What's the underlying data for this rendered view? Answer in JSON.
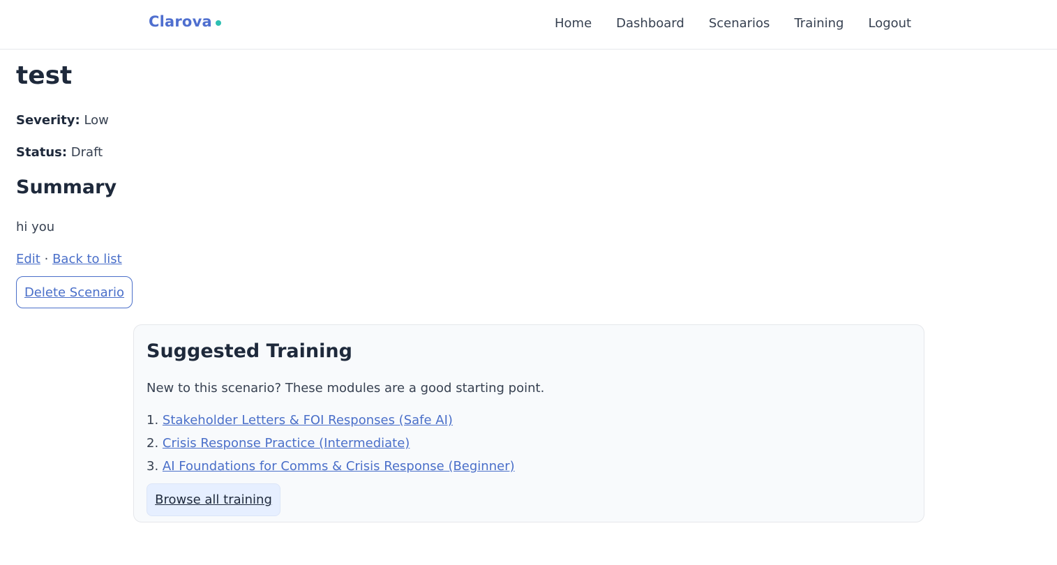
{
  "header": {
    "brand": "Clarova",
    "nav": [
      "Home",
      "Dashboard",
      "Scenarios",
      "Training",
      "Logout"
    ]
  },
  "scenario": {
    "title": "test",
    "severity_label": "Severity:",
    "severity_value": "Low",
    "status_label": "Status:",
    "status_value": "Draft",
    "summary_heading": "Summary",
    "summary_text": "hi you",
    "edit_link": "Edit",
    "separator": "·",
    "back_link": "Back to list",
    "delete_button": "Delete Scenario"
  },
  "suggested_training": {
    "heading": "Suggested Training",
    "description": "New to this scenario? These modules are a good starting point.",
    "modules": [
      {
        "number": "1.",
        "label": "Stakeholder Letters & FOI Responses (Safe AI)"
      },
      {
        "number": "2.",
        "label": "Crisis Response Practice (Intermediate)"
      },
      {
        "number": "3.",
        "label": "AI Foundations for Comms & Crisis Response (Beginner)"
      }
    ],
    "browse_button": "Browse all training"
  },
  "colors": {
    "brand": "#4f6fcf",
    "brand_dot": "#2dbfb2",
    "link": "#4a6fc9",
    "card_bg": "#f8fafc",
    "browse_bg": "#e6efff"
  }
}
